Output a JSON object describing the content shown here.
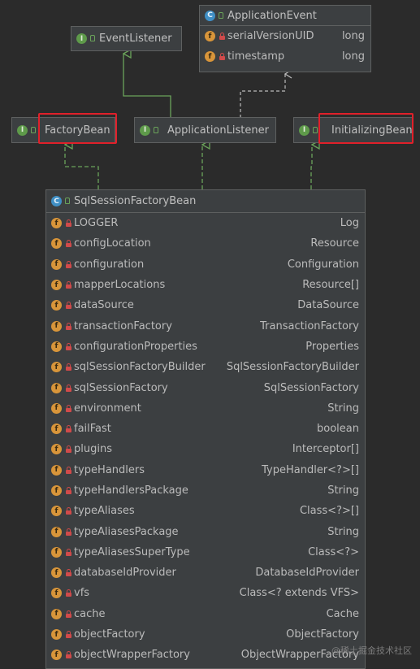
{
  "nodes": {
    "event_listener": {
      "kind": "I",
      "name": "EventListener"
    },
    "application_event": {
      "kind": "C",
      "name": "ApplicationEvent",
      "fields": [
        {
          "name": "serialVersionUID",
          "type": "long"
        },
        {
          "name": "timestamp",
          "type": "long"
        }
      ]
    },
    "factory_bean": {
      "kind": "I",
      "name": "FactoryBean"
    },
    "application_listener": {
      "kind": "I",
      "name": "ApplicationListener"
    },
    "initializing_bean": {
      "kind": "I",
      "name": "InitializingBean"
    },
    "sql_session_factory_bean": {
      "kind": "C",
      "name": "SqlSessionFactoryBean",
      "fields": [
        {
          "name": "LOGGER",
          "type": "Log"
        },
        {
          "name": "configLocation",
          "type": "Resource"
        },
        {
          "name": "configuration",
          "type": "Configuration"
        },
        {
          "name": "mapperLocations",
          "type": "Resource[]"
        },
        {
          "name": "dataSource",
          "type": "DataSource"
        },
        {
          "name": "transactionFactory",
          "type": "TransactionFactory"
        },
        {
          "name": "configurationProperties",
          "type": "Properties"
        },
        {
          "name": "sqlSessionFactoryBuilder",
          "type": "SqlSessionFactoryBuilder"
        },
        {
          "name": "sqlSessionFactory",
          "type": "SqlSessionFactory"
        },
        {
          "name": "environment",
          "type": "String"
        },
        {
          "name": "failFast",
          "type": "boolean"
        },
        {
          "name": "plugins",
          "type": "Interceptor[]"
        },
        {
          "name": "typeHandlers",
          "type": "TypeHandler<?>[]"
        },
        {
          "name": "typeHandlersPackage",
          "type": "String"
        },
        {
          "name": "typeAliases",
          "type": "Class<?>[]"
        },
        {
          "name": "typeAliasesPackage",
          "type": "String"
        },
        {
          "name": "typeAliasesSuperType",
          "type": "Class<?>"
        },
        {
          "name": "databaseIdProvider",
          "type": "DatabaseIdProvider"
        },
        {
          "name": "vfs",
          "type": "Class<? extends VFS>"
        },
        {
          "name": "cache",
          "type": "Cache"
        },
        {
          "name": "objectFactory",
          "type": "ObjectFactory"
        },
        {
          "name": "objectWrapperFactory",
          "type": "ObjectWrapperFactory"
        }
      ]
    }
  },
  "watermark": "@稀土掘金技术社区",
  "colors": {
    "background": "#2b2b2b",
    "node_fill": "#3c3f41",
    "edge_extends": "#6aa35a",
    "edge_implements": "#6aa35a",
    "edge_depends": "#bbbbbb",
    "highlight": "#e0202a"
  }
}
